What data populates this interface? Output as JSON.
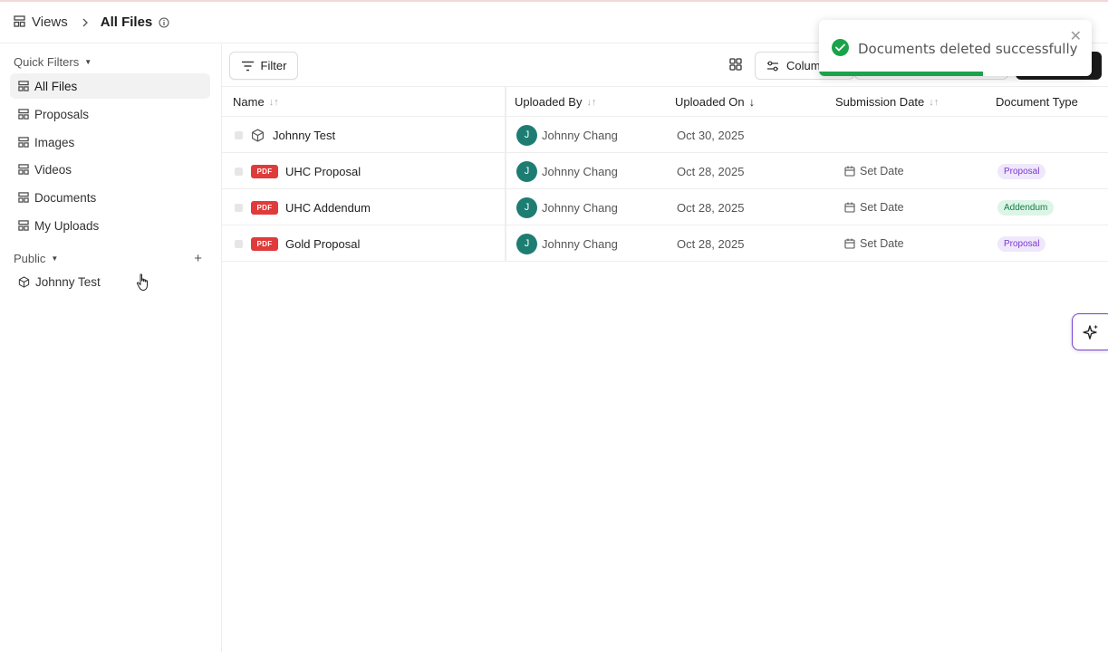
{
  "breadcrumb": {
    "root": "Views",
    "current": "All Files"
  },
  "sidebar": {
    "quick_filters_label": "Quick Filters",
    "items": [
      {
        "label": "All Files",
        "active": true
      },
      {
        "label": "Proposals"
      },
      {
        "label": "Images"
      },
      {
        "label": "Videos"
      },
      {
        "label": "Documents"
      },
      {
        "label": "My Uploads"
      }
    ],
    "public_label": "Public",
    "public_items": [
      {
        "label": "Johnny Test"
      }
    ]
  },
  "toolbar": {
    "filter_label": "Filter",
    "columns_label": "Colum"
  },
  "table": {
    "columns": [
      "Name",
      "Uploaded By",
      "Uploaded On",
      "Submission Date",
      "Document Type"
    ],
    "rows": [
      {
        "kind": "view",
        "name": "Johnny Test",
        "avatar": "J",
        "uploaded_by": "Johnny Chang",
        "uploaded_on": "Oct 30, 2025",
        "submission_date": "",
        "doc_type": ""
      },
      {
        "kind": "pdf",
        "badge": "PDF",
        "name": "UHC Proposal",
        "avatar": "J",
        "uploaded_by": "Johnny Chang",
        "uploaded_on": "Oct 28, 2025",
        "submission_date": "Set Date",
        "doc_type": "Proposal"
      },
      {
        "kind": "pdf",
        "badge": "PDF",
        "name": "UHC Addendum",
        "avatar": "J",
        "uploaded_by": "Johnny Chang",
        "uploaded_on": "Oct 28, 2025",
        "submission_date": "Set Date",
        "doc_type": "Addendum"
      },
      {
        "kind": "pdf",
        "badge": "PDF",
        "name": "Gold Proposal",
        "avatar": "J",
        "uploaded_by": "Johnny Chang",
        "uploaded_on": "Oct 28, 2025",
        "submission_date": "Set Date",
        "doc_type": "Proposal"
      }
    ]
  },
  "toast": {
    "message": "Documents deleted successfully",
    "progress": 0.6
  },
  "colors": {
    "accent_green": "#1aa34a",
    "avatar": "#1d7d72",
    "pdf_red": "#e03b3b",
    "ai_purple": "#7a3fd6"
  }
}
